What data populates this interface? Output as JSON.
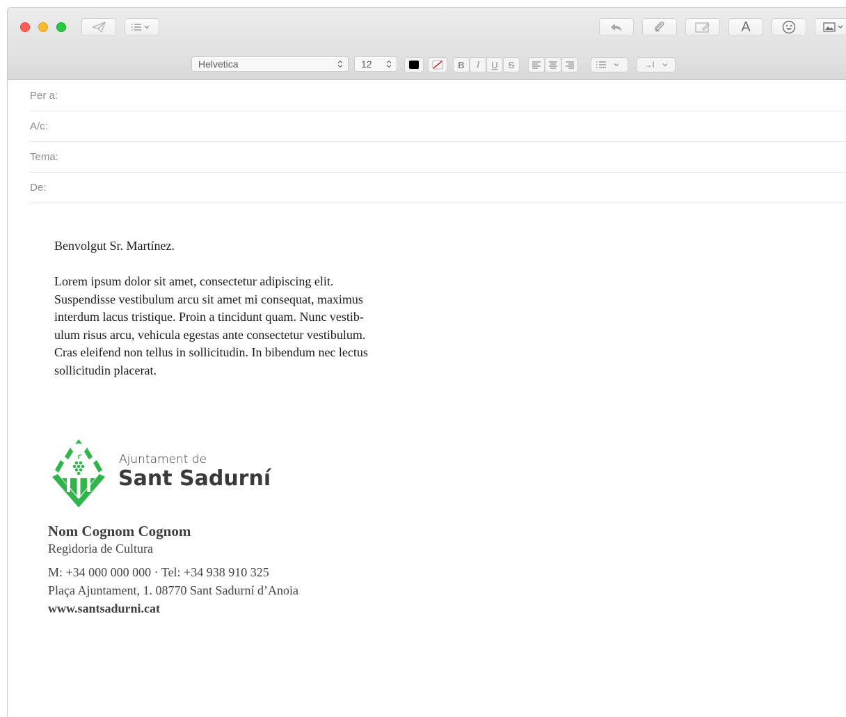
{
  "toolbar": {
    "icons": [
      "send-icon",
      "header-fields-icon",
      "reply-icon",
      "attachment-icon",
      "markup-icon",
      "format-text-icon",
      "emoji-icon",
      "photo-browser-icon"
    ],
    "format_text_label": "A"
  },
  "formatbar": {
    "font_family": "Helvetica",
    "font_size": "12",
    "text_color": "#000000",
    "bold_label": "B",
    "italic_label": "I",
    "underline_label": "U",
    "strike_label": "S",
    "indent_label": "→I"
  },
  "headers": {
    "to_label": "Per a:",
    "cc_label": "A/c:",
    "subject_label": "Tema:",
    "from_label": "De:"
  },
  "message": {
    "greeting": "Benvolgut Sr. Martínez.",
    "paragraph_lines": [
      "Lorem ipsum dolor sit amet, consectetur adipiscing elit.",
      "Suspendisse vestibulum arcu sit amet mi consequat, maximus",
      "interdum lacus tristique. Proin a tincidunt quam. Nunc vestib-",
      "ulum risus arcu, vehicula egestas ante consectetur vestibulum.",
      "Cras eleifend non tellus in sollicitudin. In bibendum nec lectus",
      "sollicitudin placerat."
    ]
  },
  "signature": {
    "logo_line1": "Ajuntament de",
    "logo_line2": "Sant Sadurní",
    "name": "Nom Cognom Cognom",
    "department": "Regidoria de Cultura",
    "phones": "M: +34 000 000 000 · Tel: +34 938 910 325",
    "address": "Plaça Ajuntament, 1. 08770 Sant Sadurní d’Anoia",
    "website": "www.santsadurni.cat",
    "brand_color": "#2fb54a"
  }
}
